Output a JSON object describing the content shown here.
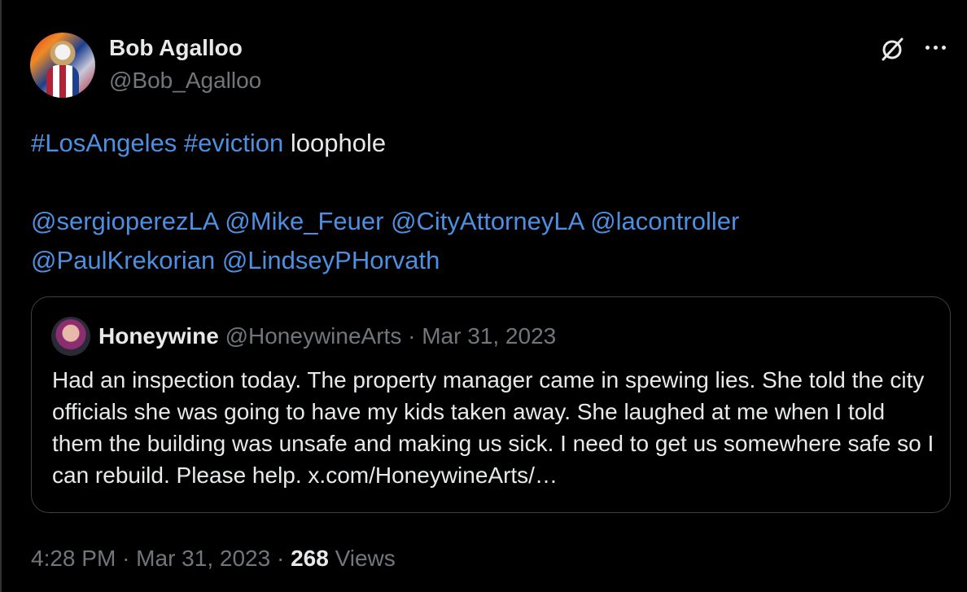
{
  "author": {
    "display_name": "Bob Agalloo",
    "handle": "@Bob_Agalloo"
  },
  "tweet": {
    "hashtags": [
      "#LosAngeles",
      "#eviction"
    ],
    "text_after_hashtags": "loophole",
    "mentions_line1": [
      "@sergioperezLA",
      "@Mike_Feuer",
      "@CityAttorneyLA",
      "@lacontroller"
    ],
    "mentions_line2": [
      "@PaulKrekorian",
      "@LindseyPHorvath"
    ]
  },
  "quoted_tweet": {
    "display_name": "Honeywine",
    "handle": "@HoneywineArts",
    "date_sep": "·",
    "date": "Mar 31, 2023",
    "text": "Had an inspection today. The property manager came in spewing lies. She told the city officials she was going to have my kids taken away. She laughed at me when I told them the building was unsafe and making us sick. I need to get us somewhere safe so I can rebuild. Please help. x.com/HoneywineArts/…"
  },
  "footer": {
    "time": "4:28 PM",
    "sep1": "·",
    "date": "Mar 31, 2023",
    "sep2": "·",
    "views_count": "268",
    "views_label": "Views"
  },
  "colors": {
    "background": "#000000",
    "text": "#e7e9ea",
    "muted": "#71767b",
    "link": "#4d8fe0",
    "border": "#3b3f44"
  },
  "icons": [
    "grok-icon",
    "more-options-icon"
  ]
}
